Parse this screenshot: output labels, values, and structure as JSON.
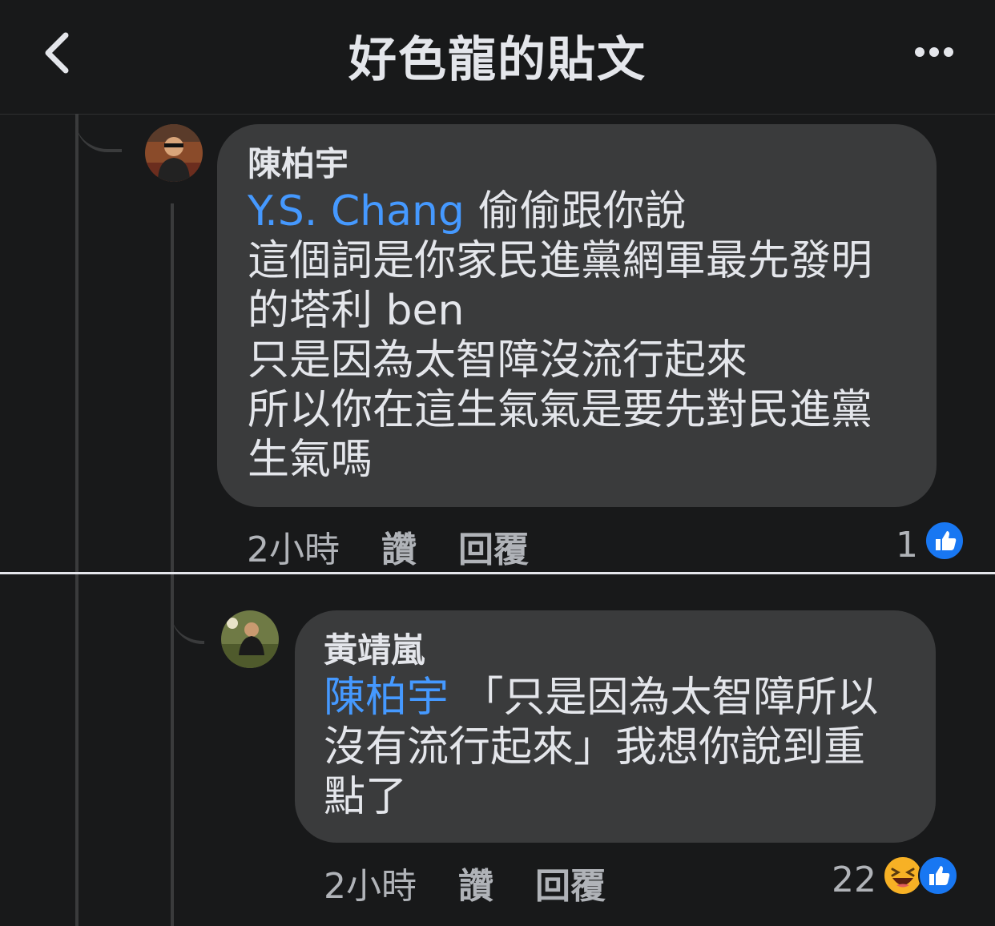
{
  "header": {
    "title": "好色龍的貼文"
  },
  "comments": [
    {
      "author": "陳柏宇",
      "mention": "Y.S. Chang",
      "text_first": " 偷偷跟你說",
      "lines": [
        "這個詞是你家民進黨網軍最先發明",
        "的塔利 ben",
        "只是因為太智障沒流行起來",
        "所以你在這生氣氣是要先對民進黨",
        "生氣嗎"
      ],
      "time": "2小時",
      "like_label": "讚",
      "reply_label": "回覆",
      "reaction_count": "1",
      "reactions": [
        "like-icon"
      ]
    },
    {
      "author": "黃靖嵐",
      "mention": "陳柏宇",
      "text_first": " 「只是因為太智障所以",
      "lines": [
        "沒有流行起來」我想你說到重",
        "點了"
      ],
      "time": "2小時",
      "like_label": "讚",
      "reply_label": "回覆",
      "reaction_count": "22",
      "reactions": [
        "haha-icon",
        "like-icon"
      ]
    }
  ],
  "colors": {
    "background": "#18191a",
    "bubble": "#3a3b3c",
    "mention": "#4599ff",
    "like": "#1877f2"
  }
}
